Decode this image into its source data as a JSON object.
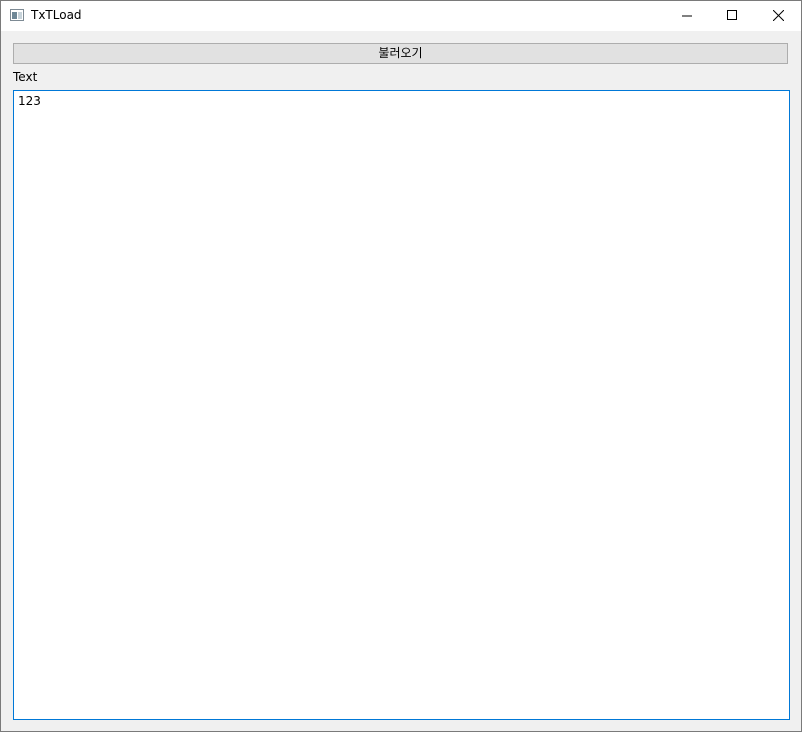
{
  "window": {
    "title": "TxTLoad",
    "icon": "app-window-icon",
    "controls": {
      "minimize_icon": "minimize-icon",
      "maximize_icon": "maximize-icon",
      "close_icon": "close-icon"
    }
  },
  "form": {
    "load_button_label": "불러오기",
    "text_label": "Text",
    "text_value": "123"
  },
  "colors": {
    "titlebar": "#ffffff",
    "client_background": "#f0f0f0",
    "button_face": "#e1e1e1",
    "button_border": "#adadad",
    "focus_border": "#0078d7",
    "window_border": "#7a7a7a"
  }
}
